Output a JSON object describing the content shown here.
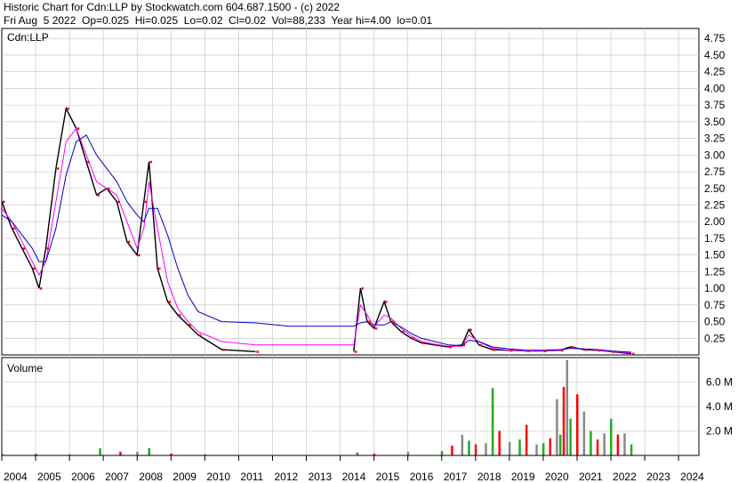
{
  "header": {
    "line1": "Historic Chart for Cdn:LLP by Stockwatch.com 604.687.1500 - (c) 2022",
    "line2": "Fri Aug  5 2022  Op=0.025  Hi=0.025  Lo=0.02  Cl=0.02  Vol=88,233  Year hi=4.00  lo=0.01"
  },
  "chart_data": [
    {
      "type": "line",
      "title": "Cdn:LLP",
      "ylim": [
        0,
        4.9
      ],
      "yticks": [
        "4.75",
        "4.50",
        "4.25",
        "4.00",
        "3.75",
        "3.50",
        "3.25",
        "3.00",
        "2.75",
        "2.50",
        "2.25",
        "2.00",
        "1.75",
        "1.50",
        "1.25",
        "1.00",
        "0.75",
        "0.50",
        "0.25"
      ],
      "grid": true,
      "colors": {
        "price": "#000000",
        "close_dots": "#ff0000",
        "ma_short": "#ff00ff",
        "ma_long": "#0000cc",
        "grid": "#c0c0c0"
      },
      "x": [
        2004.0,
        2004.3,
        2004.6,
        2004.9,
        2005.1,
        2005.3,
        2005.6,
        2005.9,
        2006.2,
        2006.5,
        2006.8,
        2007.1,
        2007.4,
        2007.7,
        2008.0,
        2008.2,
        2008.35,
        2008.6,
        2008.9,
        2009.2,
        2009.5,
        2009.8,
        2010.5,
        2011.5,
        2012.5,
        2013.5,
        2014.4,
        2014.6,
        2014.8,
        2015.0,
        2015.3,
        2015.5,
        2015.8,
        2016.1,
        2016.4,
        2016.8,
        2017.2,
        2017.6,
        2017.8,
        2018.1,
        2018.5,
        2019.0,
        2019.5,
        2020.0,
        2020.5,
        2020.8,
        2021.2,
        2021.6,
        2022.0,
        2022.6
      ],
      "series": [
        {
          "values": [
            2.3,
            1.9,
            1.6,
            1.3,
            1.0,
            1.6,
            2.8,
            3.7,
            3.4,
            2.9,
            2.4,
            2.5,
            2.3,
            1.7,
            1.5,
            2.3,
            2.9,
            1.3,
            0.8,
            0.6,
            0.45,
            0.3,
            0.08,
            0.05,
            null,
            null,
            0.05,
            1.0,
            0.5,
            0.4,
            0.8,
            0.5,
            0.35,
            0.25,
            0.18,
            0.15,
            0.12,
            0.15,
            0.38,
            0.15,
            0.08,
            0.07,
            0.06,
            0.06,
            0.07,
            0.12,
            0.08,
            0.07,
            0.05,
            0.02
          ]
        },
        {
          "values": [
            2.2,
            2.0,
            1.7,
            1.4,
            1.2,
            1.4,
            2.3,
            3.2,
            3.4,
            3.0,
            2.6,
            2.5,
            2.4,
            2.0,
            1.6,
            1.9,
            2.6,
            1.9,
            1.1,
            0.7,
            0.5,
            0.35,
            0.2,
            0.15,
            0.15,
            0.15,
            0.15,
            0.75,
            0.6,
            0.42,
            0.6,
            0.55,
            0.4,
            0.28,
            0.2,
            0.16,
            0.13,
            0.13,
            0.3,
            0.2,
            0.1,
            0.07,
            0.06,
            0.06,
            0.07,
            0.1,
            0.09,
            0.07,
            0.05,
            0.03
          ]
        },
        {
          "values": [
            2.1,
            2.0,
            1.8,
            1.6,
            1.4,
            1.4,
            1.9,
            2.7,
            3.2,
            3.3,
            3.0,
            2.8,
            2.6,
            2.3,
            2.1,
            2.0,
            2.2,
            2.2,
            1.8,
            1.3,
            0.9,
            0.65,
            0.5,
            0.48,
            0.43,
            0.43,
            0.43,
            0.48,
            0.5,
            0.45,
            0.45,
            0.5,
            0.42,
            0.32,
            0.25,
            0.2,
            0.15,
            0.14,
            0.22,
            0.2,
            0.12,
            0.09,
            0.07,
            0.07,
            0.08,
            0.1,
            0.09,
            0.08,
            0.06,
            0.04
          ]
        }
      ]
    },
    {
      "type": "bar",
      "title": "Volume",
      "ylim": [
        0,
        8000000
      ],
      "yticks": [
        "6.0 M",
        "4.0 M",
        "2.0 M"
      ],
      "x": [
        2004.0,
        2005.0,
        2006.0,
        2006.9,
        2007.5,
        2008.0,
        2008.35,
        2009.0,
        2010.0,
        2014.5,
        2015.0,
        2016.0,
        2017.0,
        2017.3,
        2017.6,
        2017.8,
        2018.0,
        2018.3,
        2018.5,
        2018.7,
        2019.0,
        2019.3,
        2019.5,
        2019.8,
        2020.0,
        2020.2,
        2020.4,
        2020.5,
        2020.6,
        2020.7,
        2020.8,
        2021.0,
        2021.2,
        2021.4,
        2021.6,
        2021.8,
        2022.0,
        2022.2,
        2022.4,
        2022.6
      ],
      "values": [
        150000,
        120000,
        100000,
        600000,
        300000,
        300000,
        600000,
        150000,
        100000,
        250000,
        150000,
        300000,
        350000,
        800000,
        1700000,
        1200000,
        900000,
        1000000,
        5500000,
        2000000,
        1100000,
        1300000,
        2500000,
        900000,
        1000000,
        1400000,
        4600000,
        1700000,
        5600000,
        7800000,
        3000000,
        5000000,
        3600000,
        2000000,
        1300000,
        1800000,
        3000000,
        1700000,
        1800000,
        900000
      ],
      "tick_labels": [
        "2004",
        "2005",
        "2006",
        "2007",
        "2008",
        "2009",
        "2010",
        "2011",
        "2012",
        "2013",
        "2014",
        "2015",
        "2016",
        "2017",
        "2018",
        "2019",
        "2020",
        "2021",
        "2022",
        "2023",
        "2024"
      ]
    }
  ]
}
